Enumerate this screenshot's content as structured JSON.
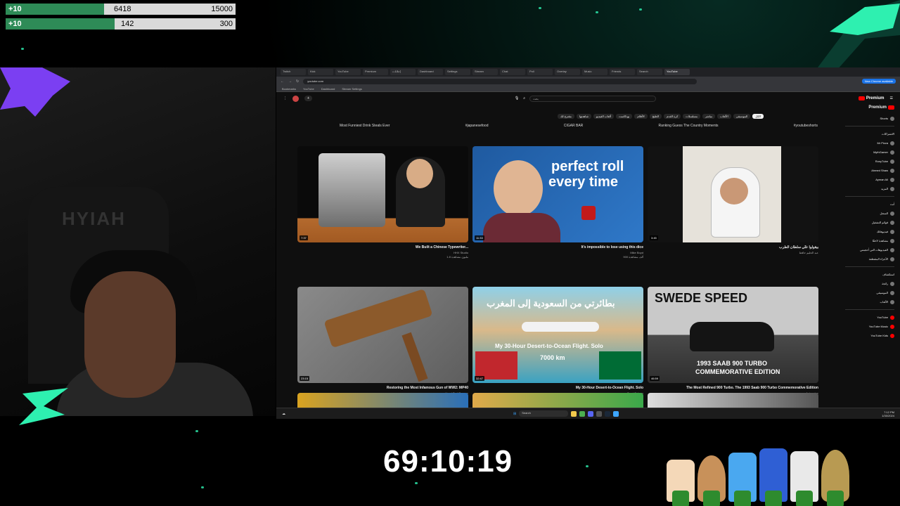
{
  "overlay": {
    "goals": [
      {
        "increment": "+10",
        "current": "6418",
        "target": "15000",
        "progress": 0.428
      },
      {
        "increment": "+10",
        "current": "142",
        "target": "300",
        "progress": 0.473
      }
    ],
    "timer": "69:10:19",
    "accent_color": "#2ef0b0"
  },
  "browser": {
    "tabs": [
      "Twitch",
      "Kick",
      "YouTube",
      "Premium",
      "إعلانات",
      "Dashboard",
      "Settings",
      "Stream",
      "Chat",
      "Poll",
      "Overlay",
      "Music",
      "Friends",
      "Search",
      "YouTube"
    ],
    "url": "youtube.com",
    "bookmarks": [
      "Bookmarks",
      "YouTube",
      "Dashboard",
      "Stream Settings"
    ],
    "premium_badge": "New Chrome available"
  },
  "youtube": {
    "search_placeholder": "بحث",
    "logo_text": "Premium",
    "chips": [
      "الكل",
      "الموسيقى",
      "الألعاب",
      "مباشر",
      "مسلسلات",
      "كرة القدم",
      "الطبخ",
      "الأفلام",
      "بودكاست",
      "ألعاب الفيديو",
      "شاهدتها",
      "مقترح لك"
    ],
    "prev_row_titles": [
      "Most Funniest Drink Steals Ever",
      "#japanesefood",
      "CIGAR BAR",
      "Ranking Guess The Country Moments",
      "#youtubeshorts"
    ],
    "videos": [
      {
        "title": "We Built a Chinese Typewriter...",
        "channel": "HHX Studio",
        "stats": "1.8 مليون مشاهدة",
        "duration": "7:37",
        "thumb": "typewriter"
      },
      {
        "title": "It's impossible to lose using this dice",
        "channel": "Mike Boyd",
        "stats": "900 ألف مشاهدة",
        "duration": "11:33",
        "thumb": "dice",
        "big_text": [
          "perfect roll",
          "every time"
        ]
      },
      {
        "title": "بيقولوا عنّي سلطان الطرب",
        "channel": "عبد الحليم حافظ",
        "stats": "",
        "duration": "3:45",
        "thumb": "singer"
      },
      {
        "title": "Restoring the Most Infamous Gun of WW2: MP40",
        "channel": "Hand Tool Rescue",
        "stats": "4.2 مليون مشاهدة",
        "duration": "23:15",
        "thumb": "gun"
      },
      {
        "title": "My 30-Hour Desert-to-Ocean Flight. Solo",
        "channel": "Trent Palmer",
        "stats": "310 ألف مشاهدة",
        "duration": "32:47",
        "thumb": "plane",
        "big_text": [
          "بطائرتي من السعودية إلى المغرب",
          "My 30-Hour Desert-to-Ocean Flight. Solo",
          "7000 km"
        ]
      },
      {
        "title": "The Most Refined 900 Turbo. The 1993 Saab 900 Turbo Commemorative Edition",
        "channel": "Autoquipe",
        "stats": "205 ألف مشاهدة",
        "duration": "46:59",
        "thumb": "saab",
        "big_text": [
          "SWEDE SPEED",
          "1993 SAAB 900 TURBO",
          "COMMEMORATIVE EDITION"
        ]
      }
    ],
    "sidebar": {
      "header": "Premium",
      "subscriptions": [
        "Shorts",
        "الاشتراكات",
        "Mr Pizza",
        "MythGamer",
        "RonyTube",
        "Ahmed Shaw",
        "Ayman Ali",
        "المزيد"
      ],
      "you": [
        "أنت",
        "السجل",
        "قوائم التشغيل",
        "فيديوهاتك",
        "مشاهدة لاحقًا",
        "الفيديوهات التي أعجبتني",
        "الأجزاء المقتطعة"
      ],
      "explore": [
        "استكشاف",
        "رائجة",
        "الموسيقى",
        "الألعاب"
      ],
      "more_from_youtube": [
        "YouTube",
        "YouTube Music",
        "YouTube Kids"
      ]
    }
  },
  "taskbar": {
    "search": "Search",
    "time": "7:12 PM",
    "date": "1/30/2024"
  }
}
